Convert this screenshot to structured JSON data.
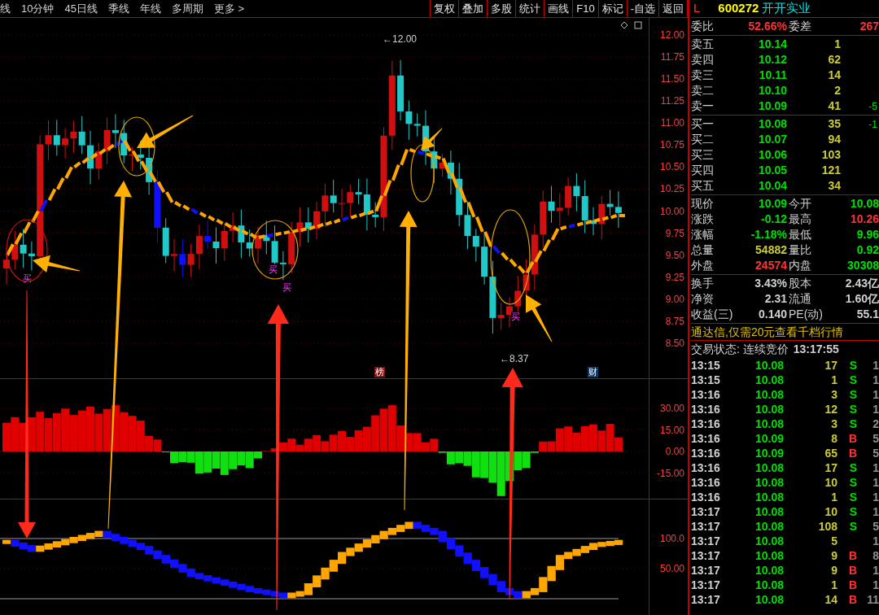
{
  "toolbar": {
    "periods": [
      "线",
      "10分钟",
      "45日线",
      "季线",
      "年线",
      "多周期",
      "更多 >"
    ],
    "buttons": [
      "复权",
      "叠加",
      "多股",
      "统计",
      "画线",
      "F10",
      "标记",
      "-自选",
      "返回"
    ]
  },
  "stock_header": {
    "flag": "L",
    "code": "600272",
    "name": "开开实业"
  },
  "price_axis": [
    "12.00",
    "11.75",
    "11.50",
    "11.25",
    "11.00",
    "10.75",
    "10.50",
    "10.25",
    "10.00",
    "9.75",
    "9.50",
    "9.25",
    "9.00",
    "8.75",
    "8.50"
  ],
  "high_marker": "←12.00",
  "low_marker": "←8.37",
  "buy_signals": [
    "买",
    "买",
    "买",
    "买"
  ],
  "event_tags": [
    {
      "label": "榜",
      "color": "#7a1010"
    },
    {
      "label": "财",
      "color": "#0b3a66"
    }
  ],
  "macd_axis": [
    "30.00",
    "15.00",
    "0.00",
    "-15.00"
  ],
  "indicator_axis": [
    "100.0",
    "50.00"
  ],
  "order_ratio": {
    "label": "委比",
    "value": "52.66%",
    "diff_label": "委差",
    "diff_value": "267"
  },
  "asks": [
    {
      "label": "卖五",
      "price": "10.14",
      "volume": "1"
    },
    {
      "label": "卖四",
      "price": "10.12",
      "volume": "62"
    },
    {
      "label": "卖三",
      "price": "10.11",
      "volume": "14"
    },
    {
      "label": "卖二",
      "price": "10.10",
      "volume": "2"
    },
    {
      "label": "卖一",
      "price": "10.09",
      "volume": "41",
      "change": "-5"
    }
  ],
  "bids": [
    {
      "label": "买一",
      "price": "10.08",
      "volume": "35",
      "change": "-1"
    },
    {
      "label": "买二",
      "price": "10.07",
      "volume": "94"
    },
    {
      "label": "买三",
      "price": "10.06",
      "volume": "103"
    },
    {
      "label": "买四",
      "price": "10.05",
      "volume": "121"
    },
    {
      "label": "买五",
      "price": "10.04",
      "volume": "34"
    }
  ],
  "quote_stats": [
    {
      "label": "现价",
      "value": "10.09",
      "color": "#00e000"
    },
    {
      "label": "今开",
      "value": "10.08",
      "color": "#00e000"
    },
    {
      "label": "涨跌",
      "value": "-0.12",
      "color": "#00e000"
    },
    {
      "label": "最高",
      "value": "10.26",
      "color": "#ff3333"
    },
    {
      "label": "涨幅",
      "value": "-1.18%",
      "color": "#00e000"
    },
    {
      "label": "最低",
      "value": "9.96",
      "color": "#00e000"
    },
    {
      "label": "总量",
      "value": "54882",
      "color": "#cccc33"
    },
    {
      "label": "量比",
      "value": "0.92",
      "color": "#00e000"
    },
    {
      "label": "外盘",
      "value": "24574",
      "color": "#ff3333"
    },
    {
      "label": "内盘",
      "value": "30308",
      "color": "#00e000"
    }
  ],
  "fundamentals": [
    {
      "label": "换手",
      "value": "3.43%"
    },
    {
      "label": "股本",
      "value": "2.43亿"
    },
    {
      "label": "净资",
      "value": "2.31"
    },
    {
      "label": "流通",
      "value": "1.60亿"
    },
    {
      "label": "收益(三)",
      "value": "0.140"
    },
    {
      "label": "PE(动)",
      "value": "55.1"
    }
  ],
  "ad_banner": "通达信,仅需20元查看千档行情",
  "trade_status": {
    "label": "交易状态: 连续竞价",
    "time": "13:17:55"
  },
  "ticks": [
    {
      "time": "13:15",
      "price": "10.08",
      "volume": "17",
      "side": "S",
      "count": "1"
    },
    {
      "time": "13:15",
      "price": "10.08",
      "volume": "1",
      "side": "S",
      "count": "1"
    },
    {
      "time": "13:16",
      "price": "10.08",
      "volume": "3",
      "side": "S",
      "count": "1"
    },
    {
      "time": "13:16",
      "price": "10.08",
      "volume": "12",
      "side": "S",
      "count": "1"
    },
    {
      "time": "13:16",
      "price": "10.08",
      "volume": "3",
      "side": "S",
      "count": "2"
    },
    {
      "time": "13:16",
      "price": "10.09",
      "volume": "8",
      "side": "B",
      "count": "5"
    },
    {
      "time": "13:16",
      "price": "10.09",
      "volume": "65",
      "side": "B",
      "count": "5"
    },
    {
      "time": "13:16",
      "price": "10.08",
      "volume": "17",
      "side": "S",
      "count": "1"
    },
    {
      "time": "13:16",
      "price": "10.08",
      "volume": "10",
      "side": "S",
      "count": "1"
    },
    {
      "time": "13:16",
      "price": "10.08",
      "volume": "1",
      "side": "S",
      "count": "1"
    },
    {
      "time": "13:17",
      "price": "10.08",
      "volume": "10",
      "side": "S",
      "count": "1"
    },
    {
      "time": "13:17",
      "price": "10.08",
      "volume": "108",
      "side": "S",
      "count": "5"
    },
    {
      "time": "13:17",
      "price": "10.08",
      "volume": "5",
      "count": "1"
    },
    {
      "time": "13:17",
      "price": "10.08",
      "volume": "9",
      "side": "B",
      "count": "8"
    },
    {
      "time": "13:17",
      "price": "10.08",
      "volume": "9",
      "side": "B",
      "count": "1"
    },
    {
      "time": "13:17",
      "price": "10.08",
      "volume": "1",
      "side": "B",
      "count": "1"
    },
    {
      "time": "13:17",
      "price": "10.08",
      "volume": "14",
      "side": "B",
      "count": "11"
    }
  ]
}
